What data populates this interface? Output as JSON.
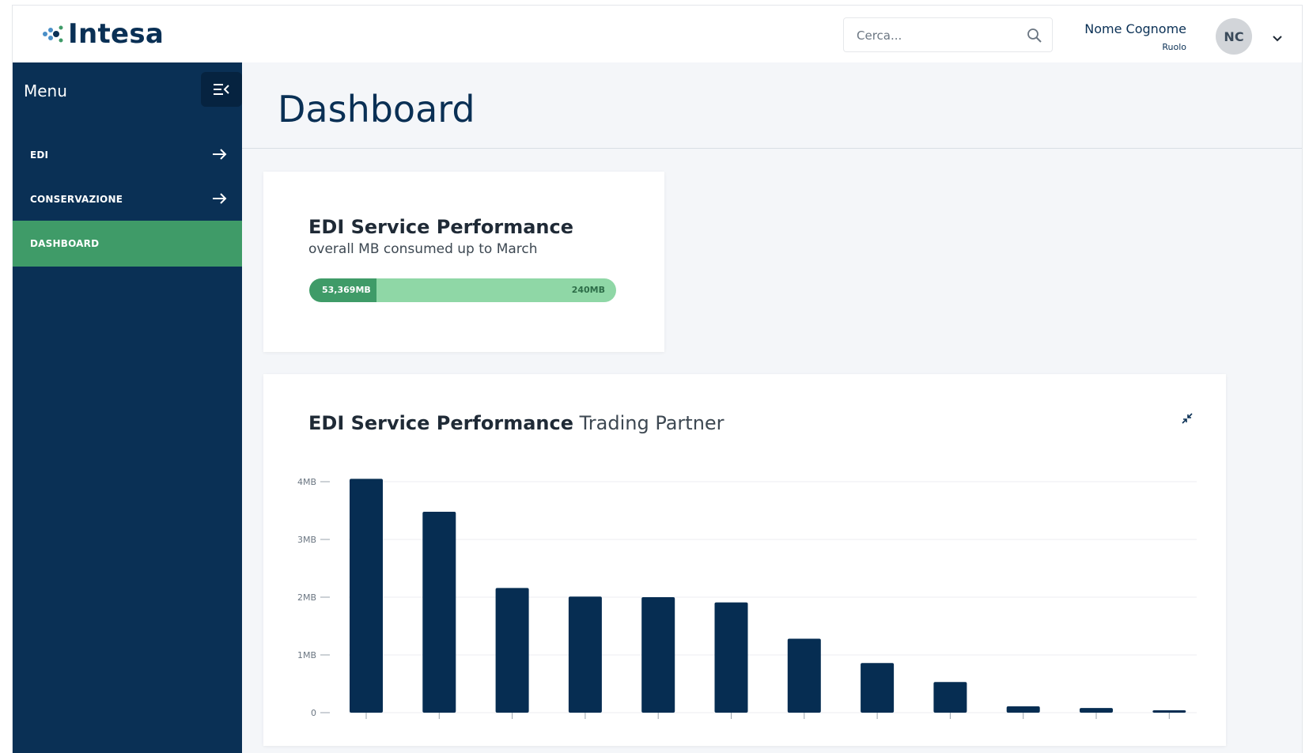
{
  "header": {
    "logo_text": "Intesa",
    "search": {
      "placeholder": "Cerca..."
    },
    "user": {
      "name": "Nome Cognome",
      "role": "Ruolo",
      "initials": "NC"
    }
  },
  "sidebar": {
    "title": "Menu",
    "items": [
      {
        "label": "EDI",
        "active": false
      },
      {
        "label": "CONSERVAZIONE",
        "active": false
      },
      {
        "label": "DASHBOARD",
        "active": true
      }
    ]
  },
  "main": {
    "page_title": "Dashboard",
    "usage_card": {
      "title": "EDI Service Performance",
      "subtitle": "overall MB consumed up to March",
      "used_label": "53,369MB",
      "total_label": "240MB",
      "used_fraction": 0.22
    },
    "chart_card": {
      "title_bold": "EDI Service Performance",
      "title_light": " Trading Partner"
    }
  },
  "colors": {
    "navy": "#0a3055",
    "green_active": "#3f9b68",
    "green_light": "#8fd7a6",
    "bar": "#062d52"
  },
  "icons": [
    "search-icon",
    "chevron-down-icon",
    "menu-collapse-icon",
    "arrow-right-icon",
    "shrink-icon"
  ],
  "chart_data": {
    "type": "bar",
    "title": "EDI Service Performance Trading Partner",
    "xlabel": "",
    "ylabel": "",
    "ylim": [
      0,
      4
    ],
    "y_ticks": [
      "0",
      "1MB",
      "2MB",
      "3MB",
      "4MB"
    ],
    "grid": true,
    "values": [
      4.05,
      3.48,
      2.16,
      2.01,
      2.0,
      1.91,
      1.28,
      0.86,
      0.53,
      0.11,
      0.08,
      0.04
    ]
  }
}
